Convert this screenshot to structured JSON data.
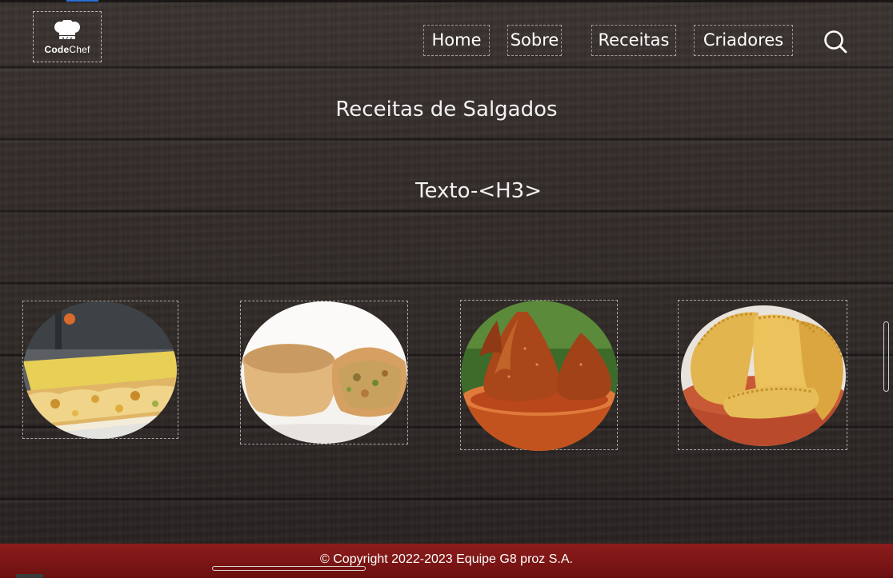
{
  "header": {
    "logo": {
      "bold": "Code",
      "light": "Chef",
      "icon": "chef-hat-icon"
    },
    "nav": [
      {
        "label": "Home"
      },
      {
        "label": "Sobre"
      },
      {
        "label": "Receitas"
      },
      {
        "label": "Criadores"
      }
    ],
    "search_icon": "search-icon"
  },
  "main": {
    "title": "Receitas de Salgados",
    "subtitle": "Texto-<H3>",
    "cards": [
      {
        "name": "empadao-de-frango"
      },
      {
        "name": "empadinha"
      },
      {
        "name": "coxinha"
      },
      {
        "name": "pastel-assado"
      }
    ]
  },
  "footer": {
    "copyright": "© Copyright 2022-2023 Equipe G8 proz S.A."
  },
  "colors": {
    "footer_bg": "#7a1515",
    "text": "#ffffff",
    "wood": "#332c29"
  }
}
